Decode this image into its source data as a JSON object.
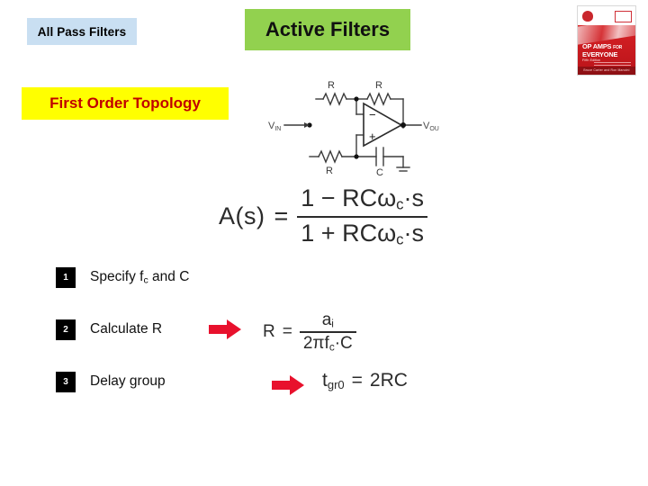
{
  "header": {
    "all_pass_chip": "All Pass Filters",
    "active_chip": "Active Filters"
  },
  "book_cover": {
    "title_line1": "OP AMPS",
    "title_for": "FOR",
    "title_line2": "EVERYONE",
    "edition": "Fifth Edition",
    "footer": "Bruce Carter and Ron Mancini",
    "colors": {
      "red": "#cf1d22",
      "dark_red": "#8e1014"
    }
  },
  "topology_banner": {
    "label": "First Order Topology",
    "background": "#ffff00",
    "text_color": "#c00000"
  },
  "circuit": {
    "name": "first-order-all-pass-active-filter",
    "input_label": "V",
    "input_sub": "IN",
    "output_label": "V",
    "output_sub": "OUT",
    "resistor_top_left": "R",
    "resistor_feedback": "R",
    "resistor_bottom": "R",
    "capacitor": "C",
    "opamp_minus": "−",
    "opamp_plus": "+"
  },
  "transfer_function": {
    "lhs": "A(s)",
    "equals": "=",
    "numerator_pre": "1 − RCω",
    "numerator_sub": "c",
    "numerator_post": "·s",
    "denominator_pre": "1 + RCω",
    "denominator_sub": "c",
    "denominator_post": "·s"
  },
  "steps": [
    {
      "number": "1",
      "label_pre": "Specify f",
      "label_sub": "c",
      "label_post": " and C"
    },
    {
      "number": "2",
      "label_pre": "Calculate R",
      "label_sub": "",
      "label_post": ""
    },
    {
      "number": "3",
      "label_pre": "Delay group",
      "label_sub": "",
      "label_post": ""
    }
  ],
  "equation_r": {
    "lhs": "R",
    "equals": "=",
    "numerator_pre": "a",
    "numerator_sub": "i",
    "denominator_pre": "2πf",
    "denominator_sub": "c",
    "denominator_post": "·C"
  },
  "equation_tgr": {
    "lhs": "t",
    "lhs_sub": "gr0",
    "equals": "=",
    "rhs": "2RC"
  },
  "arrows": {
    "color": "#e8112d",
    "arrow_1_name": "red-arrow-calculate-r",
    "arrow_2_name": "red-arrow-delay-group"
  }
}
